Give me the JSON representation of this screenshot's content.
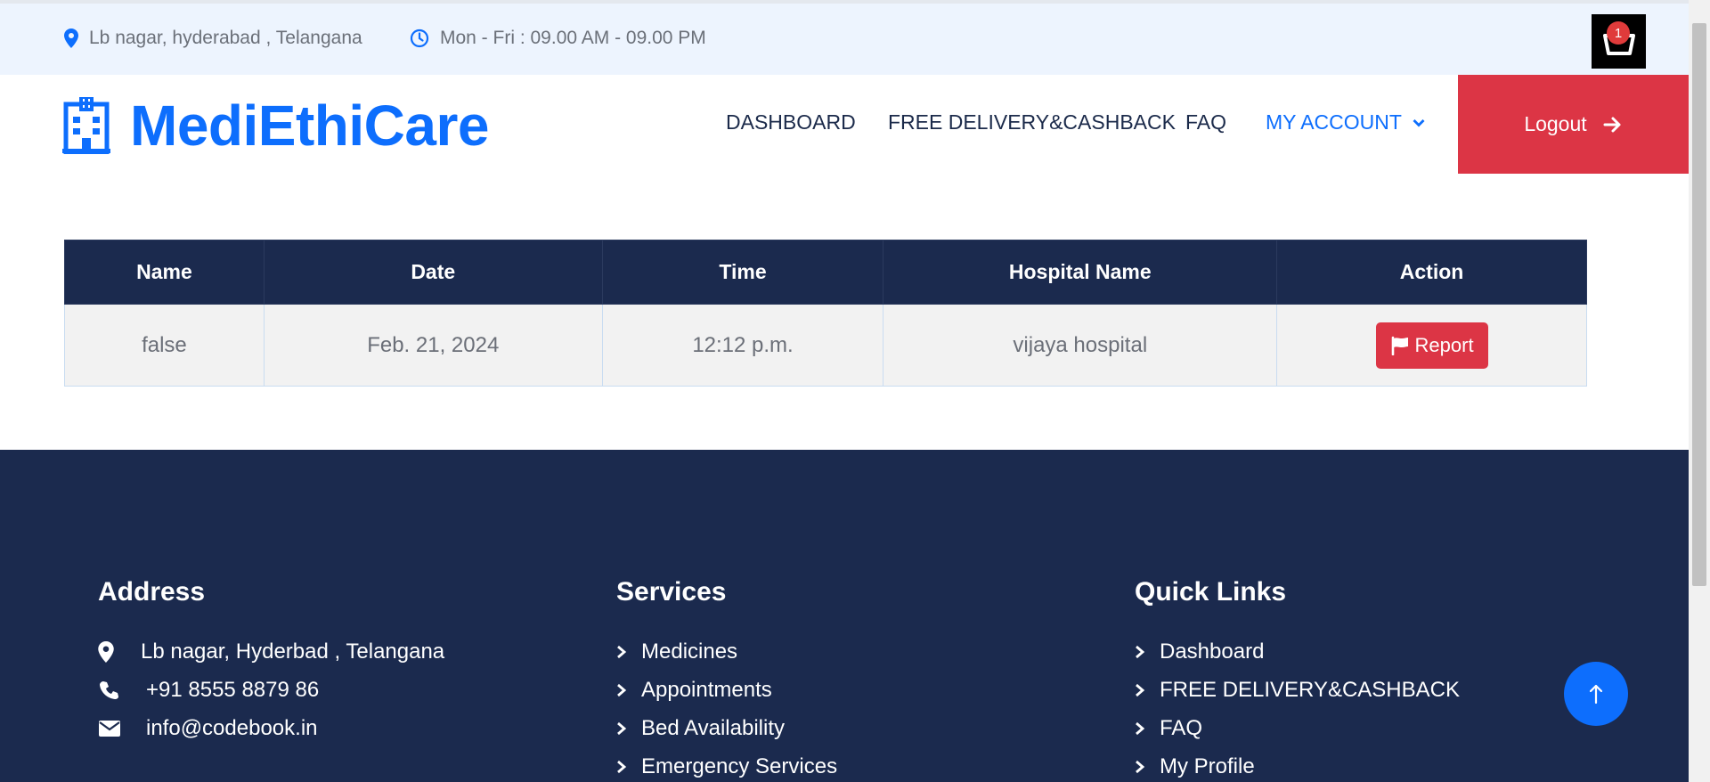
{
  "topbar": {
    "address": "Lb nagar, hyderabad , Telangana",
    "hours": "Mon - Fri : 09.00 AM - 09.00 PM",
    "cart_count": "1"
  },
  "header": {
    "brand": "MediEthiCare",
    "nav": {
      "dashboard": "DASHBOARD",
      "delivery": "FREE DELIVERY&CASHBACK",
      "faq": "FAQ",
      "account": "MY ACCOUNT"
    },
    "logout": "Logout"
  },
  "table": {
    "headers": [
      "Name",
      "Date",
      "Time",
      "Hospital Name",
      "Action"
    ],
    "rows": [
      {
        "name": "false",
        "date": "Feb. 21, 2024",
        "time": "12:12 p.m.",
        "hospital": "vijaya hospital",
        "action": "Report"
      }
    ]
  },
  "footer": {
    "address": {
      "title": "Address",
      "location": "Lb nagar, Hyderbad , Telangana",
      "phone": "+91 8555 8879 86",
      "email": "info@codebook.in"
    },
    "services": {
      "title": "Services",
      "items": [
        "Medicines",
        "Appointments",
        "Bed Availability",
        "Emergency Services"
      ]
    },
    "links": {
      "title": "Quick Links",
      "items": [
        "Dashboard",
        "FREE DELIVERY&CASHBACK",
        "FAQ",
        "My Profile"
      ]
    }
  },
  "colors": {
    "brand": "#0d6efd",
    "navy": "#1b2a4e",
    "danger": "#dc3545"
  }
}
